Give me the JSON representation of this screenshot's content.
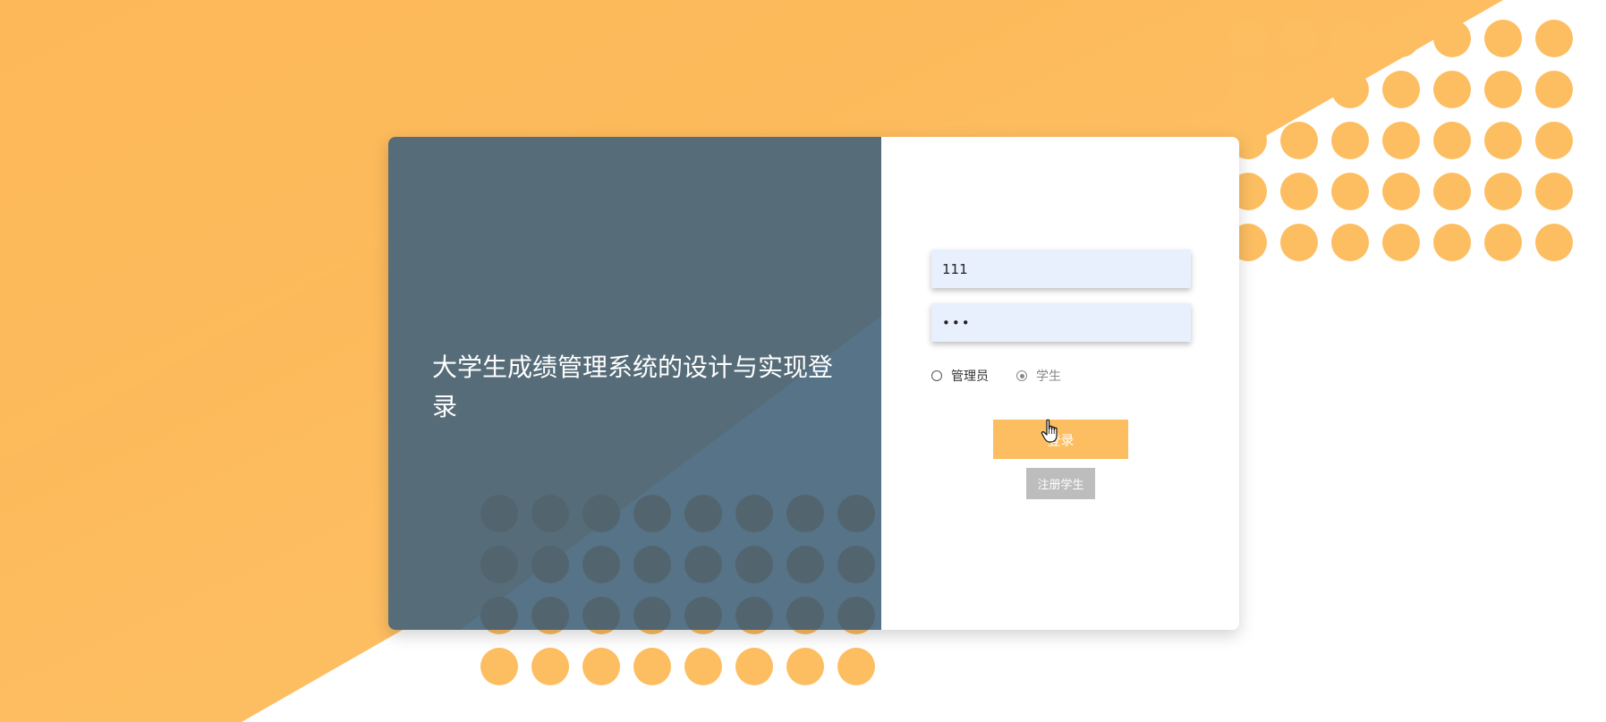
{
  "colors": {
    "accent": "#fdbe61",
    "panel": "#566c78",
    "input_bg": "#e8f0fe",
    "register_bg": "#bdbdbd"
  },
  "app": {
    "title": "大学生成绩管理系统的设计与实现登录"
  },
  "login_form": {
    "username_value": "111",
    "password_value": "•••",
    "roles": [
      {
        "label": "管理员",
        "checked": false
      },
      {
        "label": "学生",
        "checked": true
      }
    ],
    "login_label": "登录",
    "register_label": "注册学生"
  },
  "icons": {
    "cursor": "hand-pointer-icon"
  }
}
